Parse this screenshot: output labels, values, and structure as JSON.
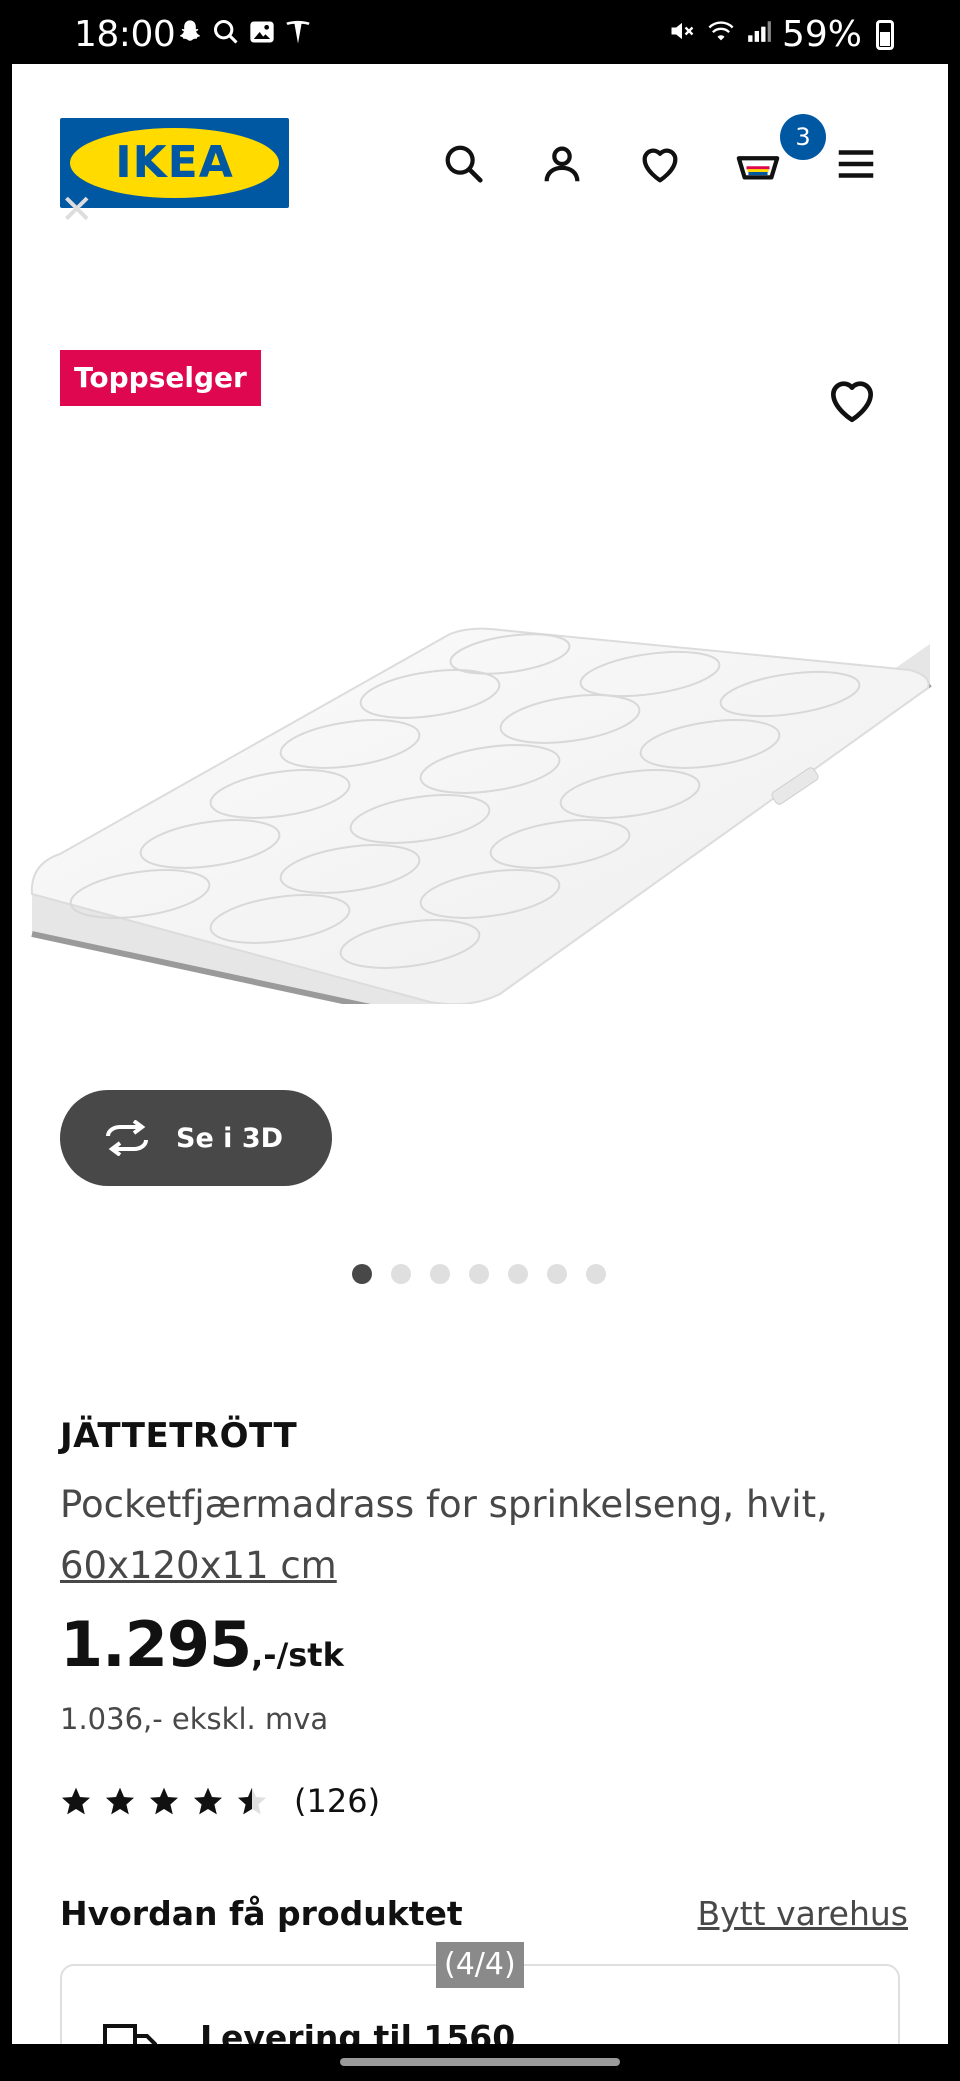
{
  "status_bar": {
    "time": "18:00",
    "battery": "59%",
    "left_icons": [
      "snapchat-icon",
      "search-icon",
      "gallery-icon",
      "tesla-icon"
    ],
    "right_icons": [
      "mute-icon",
      "wifi-icon",
      "signal-icon",
      "battery-icon"
    ]
  },
  "header": {
    "logo_text": "IKEA",
    "cart_count": "3",
    "icons": [
      "search-icon",
      "account-icon",
      "heart-icon",
      "cart-icon",
      "menu-icon"
    ]
  },
  "product_image": {
    "badge": "Toppselger",
    "view_3d_label": "Se i 3D",
    "carousel_count": 7,
    "carousel_active_index": 0
  },
  "product": {
    "name": "JÄTTETRÖTT",
    "description": "Pocketfjærmadrass for sprinkelseng, hvit,",
    "size": "60x120x11 cm",
    "price": "1.295",
    "price_unit": ",-/stk",
    "price_ex_vat": "1.036,- ekskl. mva",
    "rating": 4.5,
    "rating_max": 5,
    "rating_count": "(126)"
  },
  "delivery": {
    "section_title": "Hvordan få produktet",
    "change_store_label": "Bytt varehus",
    "delivery_label": "Levering til 1560",
    "pager_label": "(4/4)"
  },
  "colors": {
    "ikea_blue": "#0058a3",
    "ikea_yellow": "#ffdb00",
    "badge_red": "#e00751",
    "dark_grey": "#484848"
  }
}
